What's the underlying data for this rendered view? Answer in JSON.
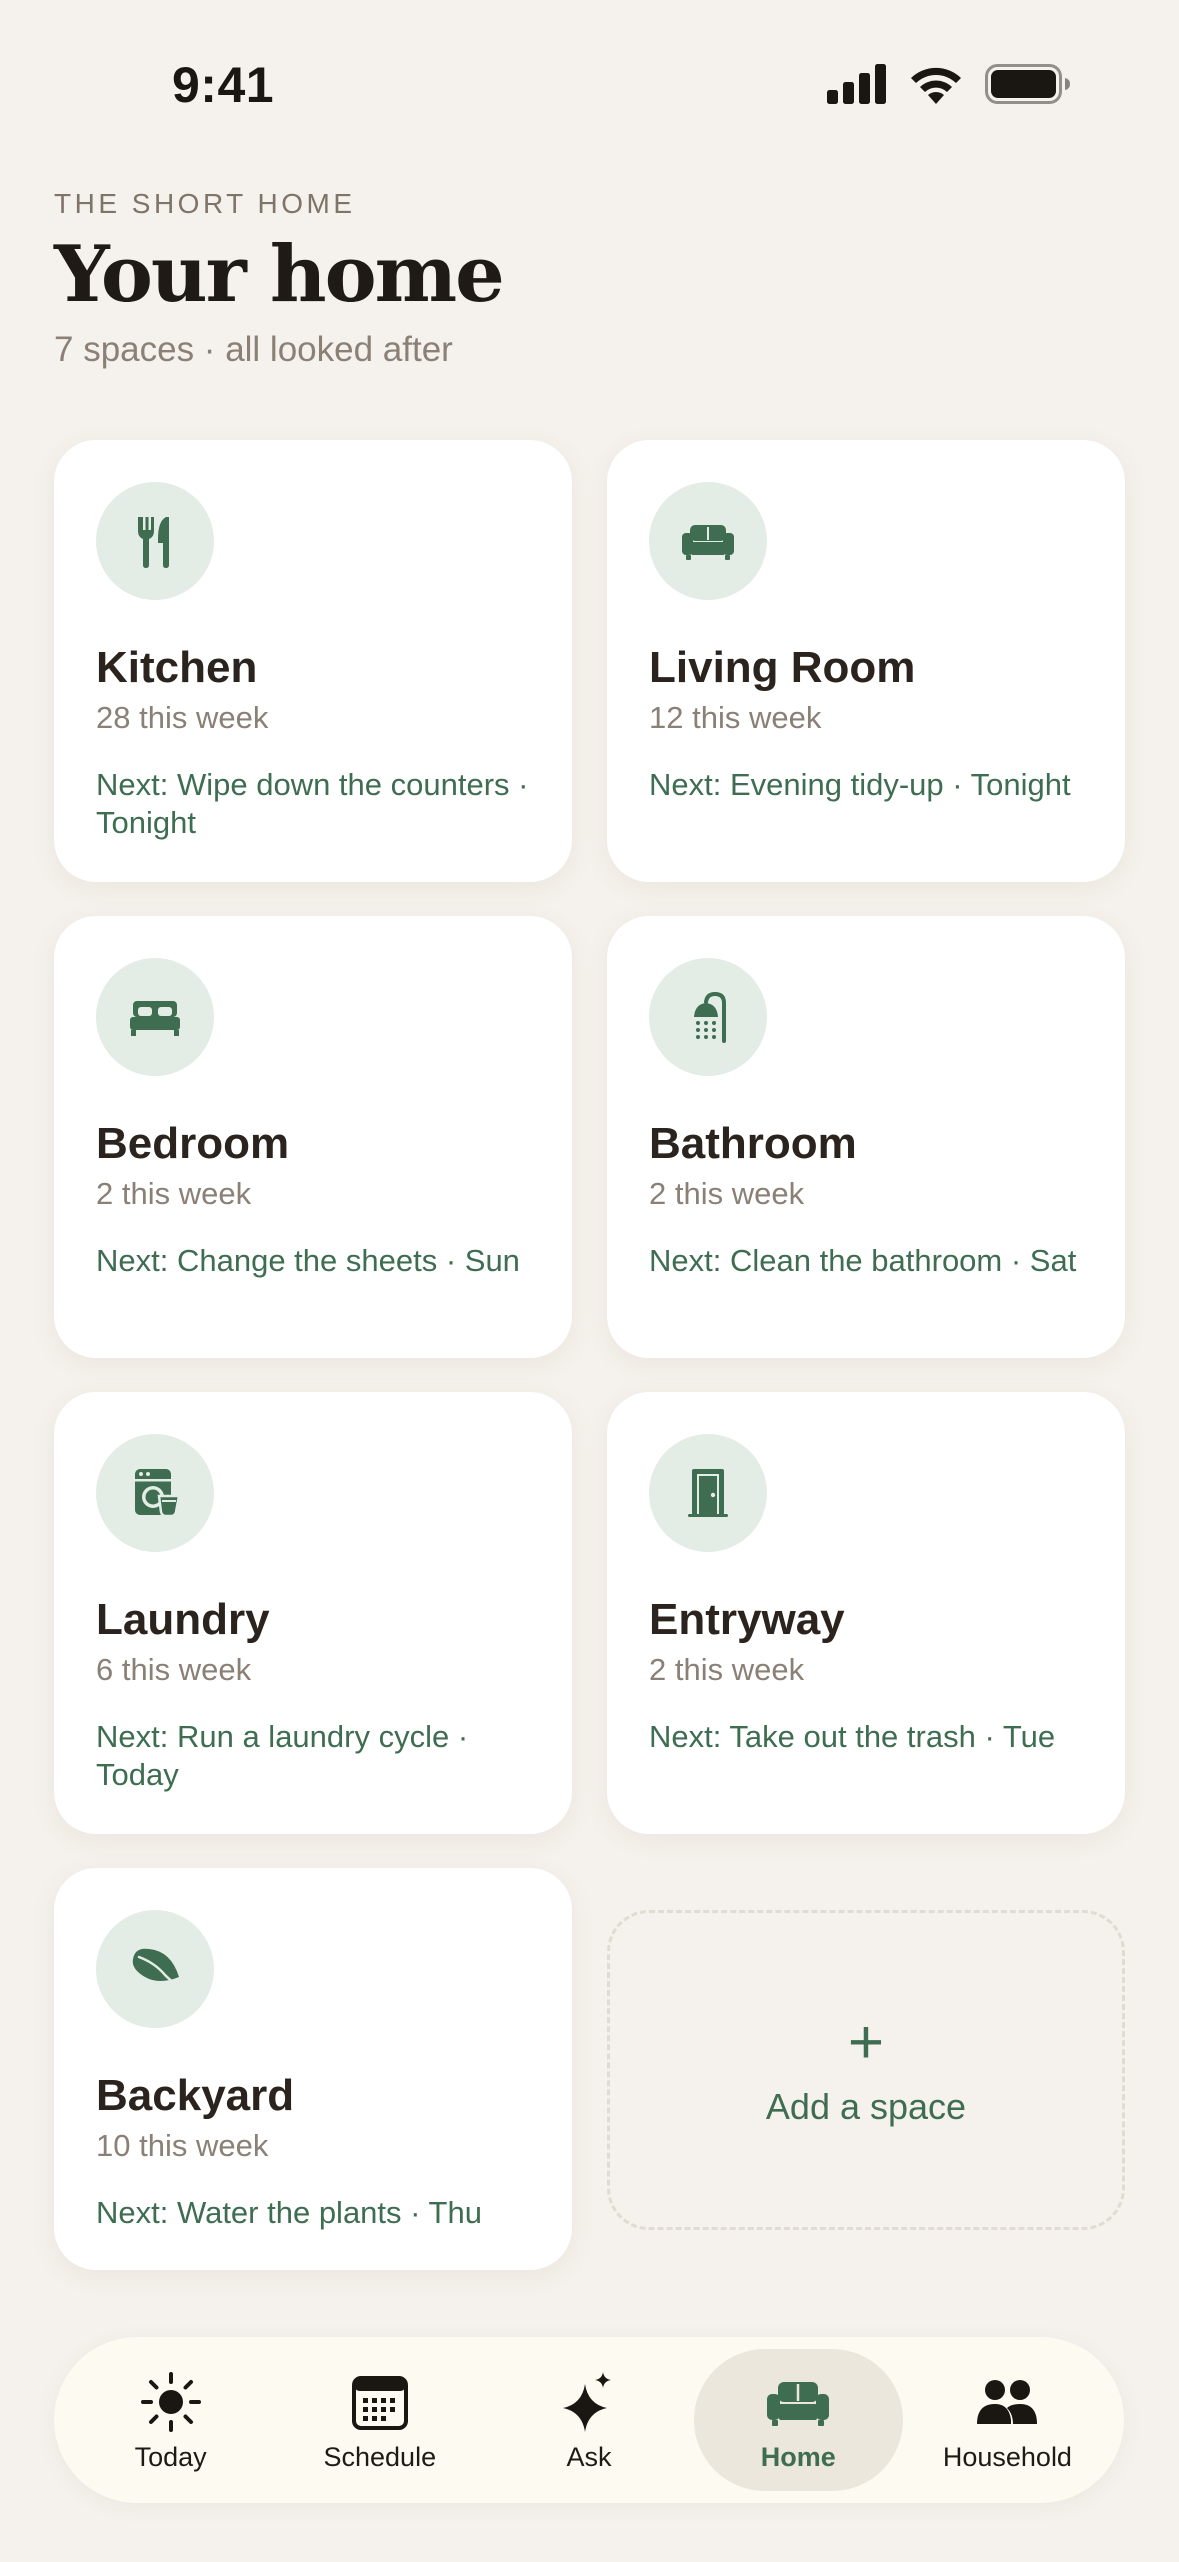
{
  "status": {
    "time": "9:41"
  },
  "header": {
    "eyebrow": "THE SHORT HOME",
    "title": "Your home",
    "subtitle": "7 spaces · all looked after"
  },
  "spaces": [
    {
      "name": "Kitchen",
      "count": "28 this week",
      "next": "Next: Wipe down the counters · Tonight",
      "icon": "fork-knife-icon"
    },
    {
      "name": "Living Room",
      "count": "12 this week",
      "next": "Next: Evening tidy-up · Tonight",
      "icon": "sofa-icon"
    },
    {
      "name": "Bedroom",
      "count": "2 this week",
      "next": "Next: Change the sheets · Sun",
      "icon": "bed-icon"
    },
    {
      "name": "Bathroom",
      "count": "2 this week",
      "next": "Next: Clean the bathroom · Sat",
      "icon": "shower-icon"
    },
    {
      "name": "Laundry",
      "count": "6 this week",
      "next": "Next: Run a laundry cycle · Today",
      "icon": "washing-machine-icon"
    },
    {
      "name": "Entryway",
      "count": "2 this week",
      "next": "Next: Take out the trash · Tue",
      "icon": "door-icon"
    },
    {
      "name": "Backyard",
      "count": "10 this week",
      "next": "Next: Water the plants · Thu",
      "icon": "leaf-icon"
    }
  ],
  "add_space": {
    "plus": "+",
    "label": "Add a space"
  },
  "tabs": [
    {
      "label": "Today",
      "icon": "sun-icon"
    },
    {
      "label": "Schedule",
      "icon": "calendar-icon"
    },
    {
      "label": "Ask",
      "icon": "sparkle-icon"
    },
    {
      "label": "Home",
      "icon": "sofa-icon",
      "active": true
    },
    {
      "label": "Household",
      "icon": "people-icon"
    }
  ],
  "colors": {
    "background": "#f5f1ec",
    "accent": "#3f6d51",
    "icon_circle": "#e3ece5",
    "card": "#ffffff"
  }
}
